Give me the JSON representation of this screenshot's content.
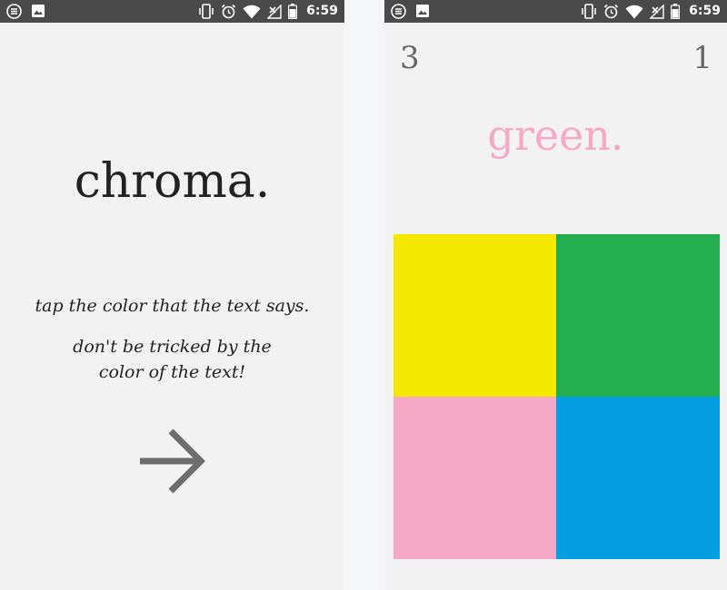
{
  "status_bar": {
    "time": "6:59",
    "icons_left": [
      "notification-circle-icon",
      "image-icon"
    ],
    "icons_right": [
      "vibrate-icon",
      "alarm-icon",
      "wifi-icon",
      "no-signal-icon",
      "battery-icon"
    ],
    "background": "#4a4a4a"
  },
  "start_screen": {
    "title": "chroma.",
    "instruction_line1": "tap the color that the text says.",
    "instruction_line2": "don't be tricked by the color of the text!",
    "start_icon": "arrow-right-icon"
  },
  "game_screen": {
    "score_left": "3",
    "score_right": "1",
    "word": "green.",
    "word_color": "#f5a9c5",
    "tiles": [
      {
        "name": "yellow",
        "color": "#f5e800"
      },
      {
        "name": "green",
        "color": "#25ae4d"
      },
      {
        "name": "pink",
        "color": "#f5a9c5"
      },
      {
        "name": "blue",
        "color": "#049fe2"
      }
    ]
  }
}
